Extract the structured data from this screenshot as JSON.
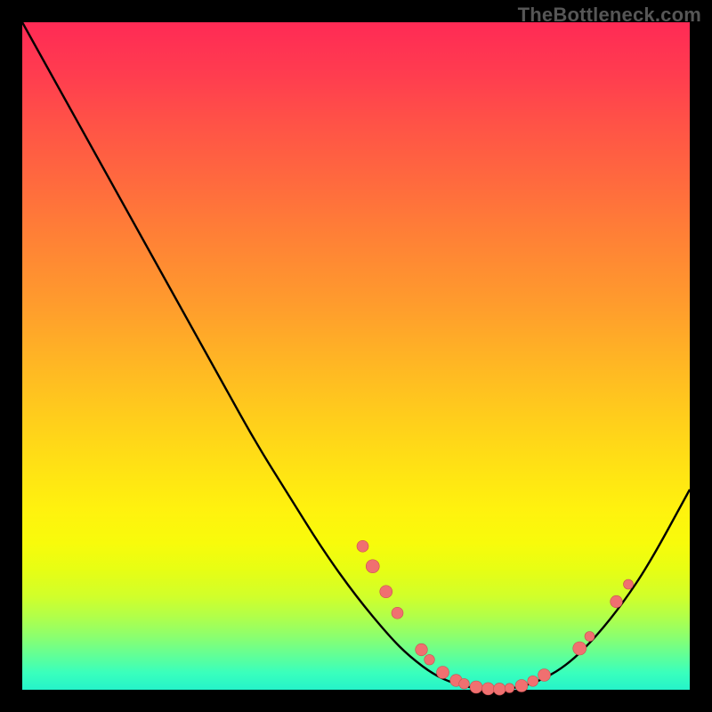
{
  "attribution": "TheBottleneck.com",
  "colors": {
    "curve": "#000000",
    "dot_fill": "#f07070",
    "dot_stroke": "#c94f4f"
  },
  "chart_data": {
    "type": "line",
    "title": "",
    "xlabel": "",
    "ylabel": "",
    "xlim": [
      0,
      100
    ],
    "ylim": [
      0,
      100
    ],
    "series": [
      {
        "name": "curve",
        "x": [
          0,
          5,
          10,
          15,
          20,
          25,
          30,
          35,
          40,
          45,
          50,
          55,
          58,
          62,
          66,
          70,
          74,
          78,
          82,
          86,
          90,
          94,
          100
        ],
        "y": [
          100,
          91,
          82,
          73,
          64,
          55,
          46,
          37,
          29,
          21,
          14,
          8,
          5,
          2,
          0.5,
          0,
          0.2,
          1.5,
          4,
          8,
          13,
          19,
          30
        ]
      }
    ],
    "points": [
      {
        "x": 51.0,
        "y": 21.5,
        "r": 6.5
      },
      {
        "x": 52.5,
        "y": 18.5,
        "r": 7.5
      },
      {
        "x": 54.5,
        "y": 14.7,
        "r": 7.0
      },
      {
        "x": 56.2,
        "y": 11.5,
        "r": 6.5
      },
      {
        "x": 59.8,
        "y": 6.0,
        "r": 6.8
      },
      {
        "x": 61.0,
        "y": 4.5,
        "r": 5.8
      },
      {
        "x": 63.0,
        "y": 2.6,
        "r": 7.0
      },
      {
        "x": 65.0,
        "y": 1.4,
        "r": 6.8
      },
      {
        "x": 66.2,
        "y": 0.9,
        "r": 5.8
      },
      {
        "x": 68.0,
        "y": 0.4,
        "r": 7.0
      },
      {
        "x": 69.8,
        "y": 0.15,
        "r": 7.0
      },
      {
        "x": 71.5,
        "y": 0.1,
        "r": 6.8
      },
      {
        "x": 73.0,
        "y": 0.25,
        "r": 5.3
      },
      {
        "x": 74.8,
        "y": 0.6,
        "r": 7.0
      },
      {
        "x": 76.5,
        "y": 1.3,
        "r": 6.0
      },
      {
        "x": 78.2,
        "y": 2.2,
        "r": 7.0
      },
      {
        "x": 83.5,
        "y": 6.2,
        "r": 7.5
      },
      {
        "x": 85.0,
        "y": 8.0,
        "r": 5.5
      },
      {
        "x": 89.0,
        "y": 13.2,
        "r": 6.8
      },
      {
        "x": 90.8,
        "y": 15.8,
        "r": 5.5
      }
    ]
  }
}
